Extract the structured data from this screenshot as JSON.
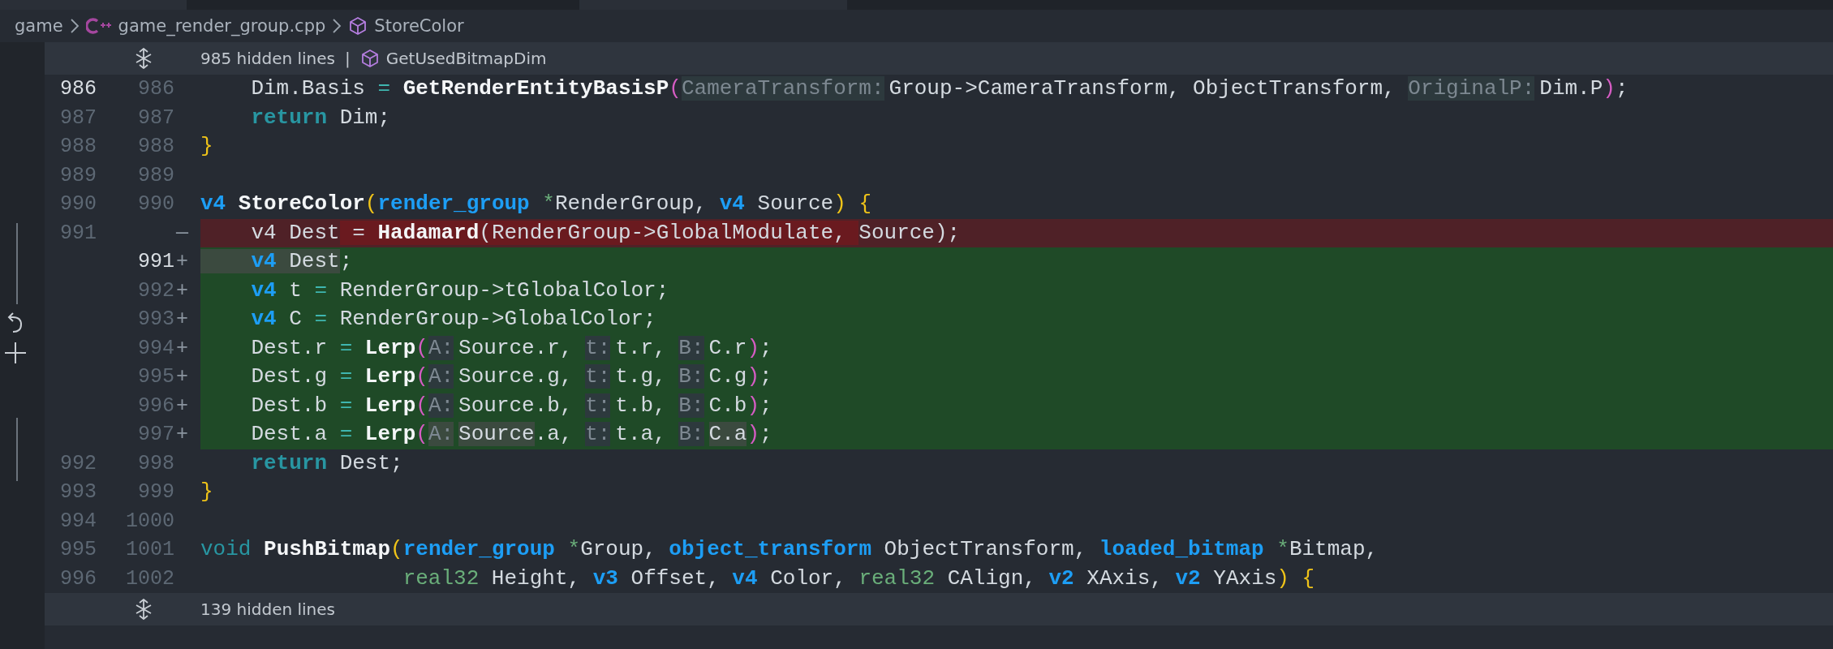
{
  "breadcrumb": [
    {
      "kind": "folder",
      "label": "game"
    },
    {
      "kind": "cpp-file",
      "label": "game_render_group.cpp"
    },
    {
      "kind": "symbol",
      "label": "StoreColor"
    }
  ],
  "top_fold": {
    "label": "985 hidden lines",
    "separator": "|",
    "symbol": "GetUsedBitmapDim"
  },
  "lines": [
    {
      "old": {
        "text": "986",
        "current": true
      },
      "new": {
        "text": "986",
        "current": false
      },
      "kind": "context",
      "tokens": [
        {
          "t": "    Dim.Basis ",
          "kind": "plain"
        },
        {
          "t": "=",
          "kind": "op"
        },
        {
          "t": " GetRenderEntityBasisP",
          "kind": "func"
        },
        {
          "t": "(",
          "kind": "pink"
        },
        {
          "t": "CameraTransform:",
          "kind": "hint"
        },
        {
          "t": "Group->CameraTransform, ObjectTransform, ",
          "kind": "plain"
        },
        {
          "t": "OriginalP:",
          "kind": "hint"
        },
        {
          "t": "Dim.P",
          "kind": "plain"
        },
        {
          "t": ")",
          "kind": "pink"
        },
        {
          "t": ";",
          "kind": "plain"
        }
      ]
    },
    {
      "old": {
        "text": "987",
        "current": false
      },
      "new": {
        "text": "987",
        "current": false
      },
      "kind": "context",
      "tokens": [
        {
          "t": "    return",
          "kind": "keyword"
        },
        {
          "t": " Dim;",
          "kind": "plain"
        }
      ]
    },
    {
      "old": {
        "text": "988",
        "current": false
      },
      "new": {
        "text": "988",
        "current": false
      },
      "kind": "context",
      "tokens": [
        {
          "t": "}",
          "kind": "yellow"
        }
      ]
    },
    {
      "old": {
        "text": "989",
        "current": false
      },
      "new": {
        "text": "989",
        "current": false
      },
      "kind": "context"
    },
    {
      "old": {
        "text": "990",
        "current": false
      },
      "new": {
        "text": "990",
        "current": false
      },
      "kind": "context",
      "tokens": [
        {
          "t": "v4",
          "kind": "type"
        },
        {
          "t": " StoreColor",
          "kind": "func"
        },
        {
          "t": "(",
          "kind": "yellow"
        },
        {
          "t": "render_group",
          "kind": "type"
        },
        {
          "t": " *",
          "kind": "prim"
        },
        {
          "t": "RenderGroup, ",
          "kind": "plain"
        },
        {
          "t": "v4",
          "kind": "type"
        },
        {
          "t": " Source",
          "kind": "plain"
        },
        {
          "t": ")",
          "kind": "yellow"
        },
        {
          "t": " {",
          "kind": "yellow"
        }
      ]
    },
    {
      "old": {
        "text": "991",
        "current": false
      },
      "marker": "—",
      "kind": "removed",
      "tokens": [
        {
          "t": "    v4 Dest",
          "kind": "plain",
          "emph": false
        },
        {
          "t": " = ",
          "kind": "plain",
          "emph": true
        },
        {
          "t": "Hadamard",
          "kind": "func",
          "emph": true
        },
        {
          "t": "(RenderGroup->GlobalModulate, ",
          "kind": "plain",
          "emph": true
        },
        {
          "t": "Source);",
          "kind": "plain",
          "emph": false
        }
      ]
    },
    {
      "new": {
        "text": "991",
        "current": true
      },
      "marker": "+",
      "kind": "added",
      "tokens": [
        {
          "t": "    v4",
          "kind": "type",
          "emph": true
        },
        {
          "t": " Dest",
          "kind": "plain",
          "emph": true
        },
        {
          "t": ";",
          "kind": "plain",
          "emph": false
        }
      ]
    },
    {
      "new": {
        "text": "992",
        "current": false
      },
      "marker": "+",
      "kind": "added",
      "tokens": [
        {
          "t": "    v4",
          "kind": "type"
        },
        {
          "t": " t ",
          "kind": "plain"
        },
        {
          "t": "=",
          "kind": "op"
        },
        {
          "t": " RenderGroup->tGlobalColor;",
          "kind": "plain"
        }
      ]
    },
    {
      "new": {
        "text": "993",
        "current": false
      },
      "marker": "+",
      "kind": "added",
      "tokens": [
        {
          "t": "    v4",
          "kind": "type"
        },
        {
          "t": " C ",
          "kind": "plain"
        },
        {
          "t": "=",
          "kind": "op"
        },
        {
          "t": " RenderGroup->GlobalColor;",
          "kind": "plain"
        }
      ]
    },
    {
      "new": {
        "text": "994",
        "current": false
      },
      "marker": "+",
      "kind": "added",
      "tokens": [
        {
          "t": "    Dest.r ",
          "kind": "plain"
        },
        {
          "t": "=",
          "kind": "op"
        },
        {
          "t": " Lerp",
          "kind": "func"
        },
        {
          "t": "(",
          "kind": "pink"
        },
        {
          "t": "A:",
          "kind": "hint"
        },
        {
          "t": "Source.r, ",
          "kind": "plain"
        },
        {
          "t": "t:",
          "kind": "hint"
        },
        {
          "t": "t.r, ",
          "kind": "plain"
        },
        {
          "t": "B:",
          "kind": "hint"
        },
        {
          "t": "C.r",
          "kind": "plain"
        },
        {
          "t": ")",
          "kind": "pink"
        },
        {
          "t": ";",
          "kind": "plain"
        }
      ]
    },
    {
      "new": {
        "text": "995",
        "current": false
      },
      "marker": "+",
      "kind": "added",
      "tokens": [
        {
          "t": "    Dest.g ",
          "kind": "plain"
        },
        {
          "t": "=",
          "kind": "op"
        },
        {
          "t": " Lerp",
          "kind": "func"
        },
        {
          "t": "(",
          "kind": "pink"
        },
        {
          "t": "A:",
          "kind": "hint"
        },
        {
          "t": "Source.g, ",
          "kind": "plain"
        },
        {
          "t": "t:",
          "kind": "hint"
        },
        {
          "t": "t.g, ",
          "kind": "plain"
        },
        {
          "t": "B:",
          "kind": "hint"
        },
        {
          "t": "C.g",
          "kind": "plain"
        },
        {
          "t": ")",
          "kind": "pink"
        },
        {
          "t": ";",
          "kind": "plain"
        }
      ]
    },
    {
      "new": {
        "text": "996",
        "current": false
      },
      "marker": "+",
      "kind": "added",
      "tokens": [
        {
          "t": "    Dest.b ",
          "kind": "plain"
        },
        {
          "t": "=",
          "kind": "op"
        },
        {
          "t": " Lerp",
          "kind": "func"
        },
        {
          "t": "(",
          "kind": "pink"
        },
        {
          "t": "A:",
          "kind": "hint"
        },
        {
          "t": "Source.b, ",
          "kind": "plain"
        },
        {
          "t": "t:",
          "kind": "hint"
        },
        {
          "t": "t.b, ",
          "kind": "plain"
        },
        {
          "t": "B:",
          "kind": "hint"
        },
        {
          "t": "C.b",
          "kind": "plain"
        },
        {
          "t": ")",
          "kind": "pink"
        },
        {
          "t": ";",
          "kind": "plain"
        }
      ]
    },
    {
      "new": {
        "text": "997",
        "current": false
      },
      "marker": "+",
      "kind": "added",
      "tokens": [
        {
          "t": "    Dest.a ",
          "kind": "plain",
          "emph": false
        },
        {
          "t": "=",
          "kind": "op",
          "emph": false
        },
        {
          "t": " Lerp",
          "kind": "func",
          "emph": false
        },
        {
          "t": "(",
          "kind": "pink",
          "emph": false
        },
        {
          "t": "A:",
          "kind": "hint",
          "emph": true
        },
        {
          "t": "Source",
          "kind": "plain",
          "emph": true
        },
        {
          "t": ".a, ",
          "kind": "plain",
          "emph": false
        },
        {
          "t": "t:",
          "kind": "hint",
          "emph": false
        },
        {
          "t": "t.a, ",
          "kind": "plain",
          "emph": false
        },
        {
          "t": "B:",
          "kind": "hint",
          "emph": false
        },
        {
          "t": "C.a",
          "kind": "plain",
          "emph": true
        },
        {
          "t": ")",
          "kind": "pink",
          "emph": false
        },
        {
          "t": ";",
          "kind": "plain",
          "emph": false
        }
      ]
    },
    {
      "old": {
        "text": "992",
        "current": false
      },
      "new": {
        "text": "998",
        "current": false
      },
      "kind": "context",
      "tokens": [
        {
          "t": "    return",
          "kind": "keyword"
        },
        {
          "t": " Dest;",
          "kind": "plain"
        }
      ]
    },
    {
      "old": {
        "text": "993",
        "current": false
      },
      "new": {
        "text": "999",
        "current": false
      },
      "kind": "context",
      "tokens": [
        {
          "t": "}",
          "kind": "yellow"
        }
      ]
    },
    {
      "old": {
        "text": "994",
        "current": false
      },
      "new": {
        "text": "1000",
        "current": false
      },
      "kind": "context"
    },
    {
      "old": {
        "text": "995",
        "current": false
      },
      "new": {
        "text": "1001",
        "current": false
      },
      "kind": "context",
      "tokens": [
        {
          "t": "void",
          "kind": "void"
        },
        {
          "t": " PushBitmap",
          "kind": "func"
        },
        {
          "t": "(",
          "kind": "yellow"
        },
        {
          "t": "render_group",
          "kind": "type"
        },
        {
          "t": " *",
          "kind": "prim"
        },
        {
          "t": "Group, ",
          "kind": "plain"
        },
        {
          "t": "object_transform",
          "kind": "type"
        },
        {
          "t": " ObjectTransform, ",
          "kind": "plain"
        },
        {
          "t": "loaded_bitmap",
          "kind": "type"
        },
        {
          "t": " *",
          "kind": "prim"
        },
        {
          "t": "Bitmap,",
          "kind": "plain"
        }
      ]
    },
    {
      "old": {
        "text": "996",
        "current": false
      },
      "new": {
        "text": "1002",
        "current": false
      },
      "kind": "context",
      "tokens": [
        {
          "t": "                real32",
          "kind": "prim"
        },
        {
          "t": " Height, ",
          "kind": "plain"
        },
        {
          "t": "v3",
          "kind": "type"
        },
        {
          "t": " Offset, ",
          "kind": "plain"
        },
        {
          "t": "v4",
          "kind": "type"
        },
        {
          "t": " Color, ",
          "kind": "plain"
        },
        {
          "t": "real32",
          "kind": "prim"
        },
        {
          "t": " CAlign, ",
          "kind": "plain"
        },
        {
          "t": "v2",
          "kind": "type"
        },
        {
          "t": " XAxis, ",
          "kind": "plain"
        },
        {
          "t": "v2",
          "kind": "type"
        },
        {
          "t": " YAxis",
          "kind": "plain"
        },
        {
          "t": ")",
          "kind": "yellow"
        },
        {
          "t": " {",
          "kind": "yellow"
        }
      ]
    }
  ],
  "bottom_fold": {
    "label": "139 hidden lines"
  }
}
